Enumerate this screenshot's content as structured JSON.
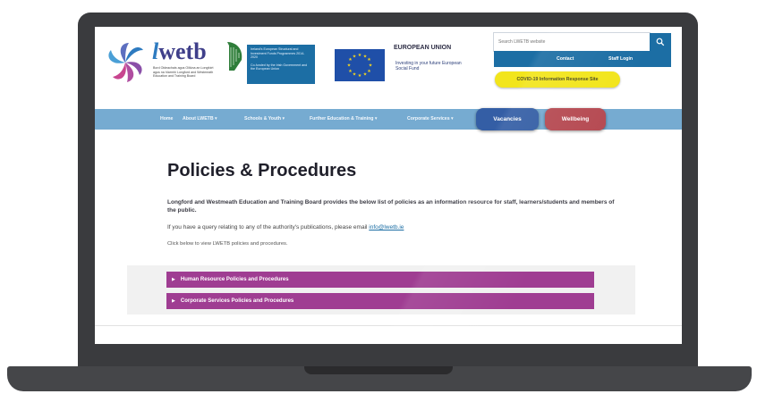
{
  "header": {
    "logo_name": "lwetb",
    "logo_prefix": "l",
    "logo_rest": "wetb",
    "logo_subtitle": "Bord Oideachais agus Oiliúna an Longfoirt agus na hIarmhí Longford and Westmeath Education and Training Board",
    "ireland_box_title": "Ireland's European Structural and Investment Funds Programmes 2014-2020",
    "ireland_box_sub": "Co-funded by the Irish Government and the European Union",
    "eu_title": "EUROPEAN UNION",
    "eu_sub": "Investing in your future European Social Fund"
  },
  "search": {
    "placeholder": "Search LWETB website",
    "button_icon": "search-icon"
  },
  "utility_links": {
    "contact": "Contact",
    "staff_login": "Staff Login"
  },
  "covid_button": "COVID-19 Information Response Site",
  "nav": {
    "items": [
      {
        "label": "Home"
      },
      {
        "label": "About LWETB ▾"
      },
      {
        "label": "Schools & Youth ▾"
      },
      {
        "label": "Further Education & Training ▾"
      },
      {
        "label": "Corporate Services ▾"
      }
    ],
    "vacancies": "Vacancies",
    "wellbeing": "Wellbeing"
  },
  "content": {
    "title": "Policies & Procedures",
    "intro": "Longford and Westmeath Education and Training Board provides the below list of policies as an information resource for staff, learners/students and members of the public.",
    "query_text": "If you have a query relating to any of the authority's publications, please email",
    "query_email": "info@lwetb.ie",
    "click_text": "Click below to view LWETB policies and procedures.",
    "accordion": [
      {
        "label": "Human Resource Policies and Procedures"
      },
      {
        "label": "Corporate Services Policies and Procedures"
      }
    ]
  },
  "colors": {
    "brand_blue": "#1c6ea4",
    "nav_blue": "#76abd1",
    "accordion_purple": "#9f3d92",
    "covid_yellow": "#f2e51c",
    "vacancies_blue": "#345ea5",
    "wellbeing_red": "#b64b53"
  }
}
